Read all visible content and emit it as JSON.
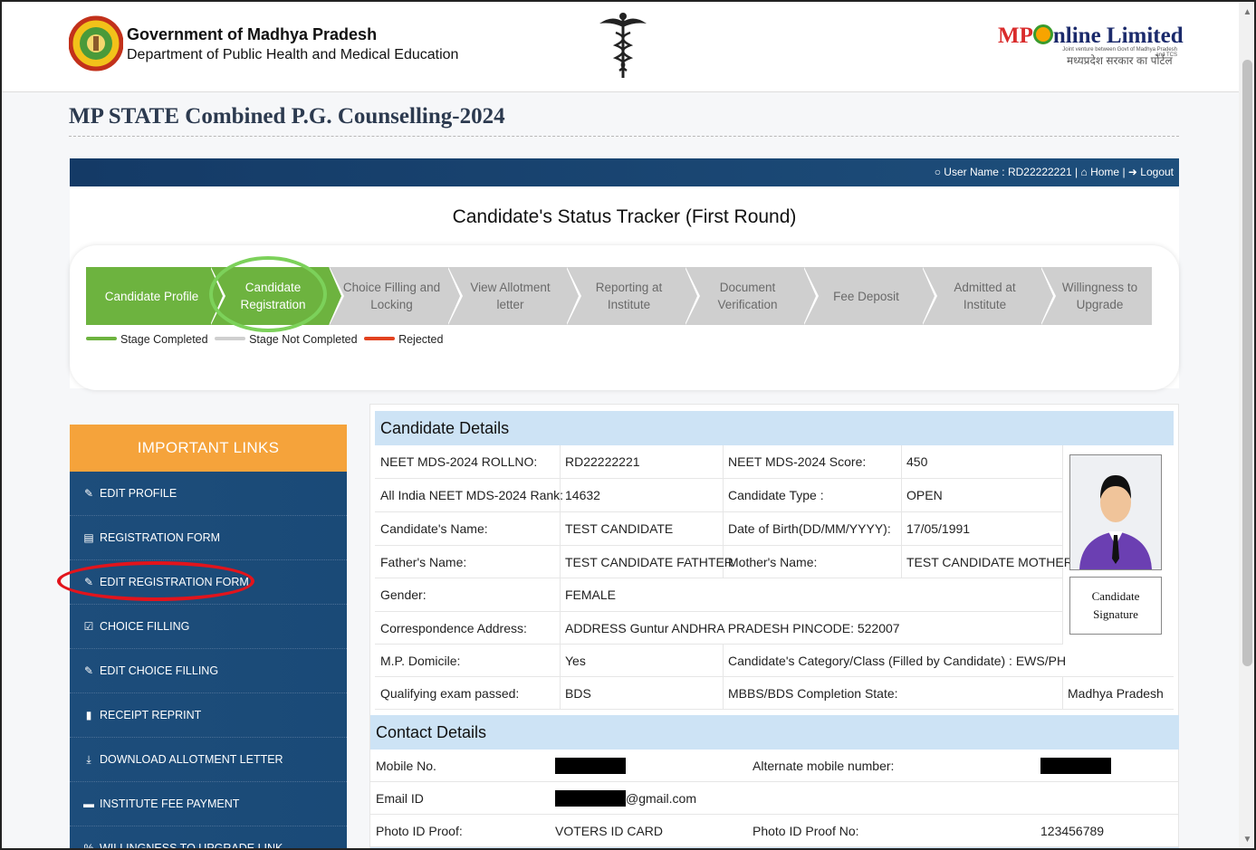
{
  "header": {
    "gov_title": "Government of Madhya Pradesh",
    "gov_subtitle": "Department of Public Health and Medical Education",
    "mp_logo": {
      "prefix": "MP",
      "suffix": "nline Limited",
      "small": "Joint venture between Govt of Madhya Pradesh and TCS",
      "hindi": "मध्यप्रदेश सरकार का पोर्टल"
    }
  },
  "page_title": "MP STATE Combined P.G. Counselling-2024",
  "nav": {
    "user_label": "User Name : RD22222221",
    "home": "Home",
    "logout": "Logout"
  },
  "tracker": {
    "title": "Candidate's Status Tracker (First Round)",
    "steps": [
      {
        "line1": "Candidate Profile",
        "line2": "",
        "status": "completed"
      },
      {
        "line1": "Candidate",
        "line2": "Registration",
        "status": "completed"
      },
      {
        "line1": "Choice Filling and",
        "line2": "Locking",
        "status": "not_completed"
      },
      {
        "line1": "View Allotment",
        "line2": "letter",
        "status": "not_completed"
      },
      {
        "line1": "Reporting at",
        "line2": "Institute",
        "status": "not_completed"
      },
      {
        "line1": "Document",
        "line2": "Verification",
        "status": "not_completed"
      },
      {
        "line1": "Fee Deposit",
        "line2": "",
        "status": "not_completed"
      },
      {
        "line1": "Admitted at",
        "line2": "Institute",
        "status": "not_completed"
      },
      {
        "line1": "Willingness to",
        "line2": "Upgrade",
        "status": "not_completed"
      }
    ],
    "legend": {
      "completed": "Stage Completed",
      "not_completed": "Stage Not Completed",
      "rejected": "Rejected"
    },
    "colors": {
      "completed": "#6db33f",
      "not_completed": "#cfcfcf",
      "rejected": "#e2421f"
    }
  },
  "sidebar": {
    "title": "IMPORTANT LINKS",
    "items": [
      {
        "icon": "edit-icon",
        "glyph": "✎",
        "label": "EDIT PROFILE"
      },
      {
        "icon": "form-icon",
        "glyph": "▤",
        "label": "REGISTRATION FORM"
      },
      {
        "icon": "edit-icon",
        "glyph": "✎",
        "label": "EDIT REGISTRATION FORM"
      },
      {
        "icon": "checkbox-icon",
        "glyph": "☑",
        "label": "CHOICE FILLING"
      },
      {
        "icon": "edit-icon",
        "glyph": "✎",
        "label": "EDIT CHOICE FILLING"
      },
      {
        "icon": "file-icon",
        "glyph": "▮",
        "label": "RECEIPT REPRINT"
      },
      {
        "icon": "download-icon",
        "glyph": "⤓",
        "label": "DOWNLOAD ALLOTMENT LETTER"
      },
      {
        "icon": "card-icon",
        "glyph": "▬",
        "label": "INSTITUTE FEE PAYMENT"
      },
      {
        "icon": "link-icon",
        "glyph": "%",
        "label": "WILLINGNESS TO UPGRADE LINK"
      }
    ]
  },
  "candidate_details": {
    "title": "Candidate Details",
    "rollno_label": "NEET MDS-2024 ROLLNO:",
    "rollno": "RD22222221",
    "score_label": "NEET MDS-2024 Score:",
    "score": "450",
    "rank_label": "All India NEET MDS-2024 Rank:",
    "rank": "14632",
    "type_label": "Candidate Type :",
    "type": "OPEN",
    "name_label": "Candidate's Name:",
    "name": "TEST CANDIDATE",
    "dob_label": "Date of Birth(DD/MM/YYYY):",
    "dob": "17/05/1991",
    "father_label": "Father's Name:",
    "father": "TEST CANDIDATE FATHTER",
    "mother_label": "Mother's Name:",
    "mother": "TEST CANDIDATE MOTHER",
    "gender_label": "Gender:",
    "gender": "FEMALE",
    "address_label": "Correspondence Address:",
    "address": "ADDRESS Guntur ANDHRA PRADESH PINCODE: 522007",
    "domicile_label": "M.P. Domicile:",
    "domicile": "Yes",
    "category": "Candidate's Category/Class (Filled by Candidate) : EWS/PH",
    "qualifying_label": "Qualifying exam passed:",
    "qualifying": "BDS",
    "completion_label": "MBBS/BDS Completion State:",
    "completion": "Madhya Pradesh",
    "signature_line1": "Candidate",
    "signature_line2": "Signature"
  },
  "contact_details": {
    "title": "Contact Details",
    "mobile_label": "Mobile No.",
    "alt_mobile_label": "Alternate mobile number:",
    "email_label": "Email ID",
    "email_suffix": "@gmail.com",
    "photo_id_label": "Photo ID Proof:",
    "photo_id": "VOTERS ID CARD",
    "photo_id_no_label": "Photo ID Proof No:",
    "photo_id_no": "123456789"
  }
}
